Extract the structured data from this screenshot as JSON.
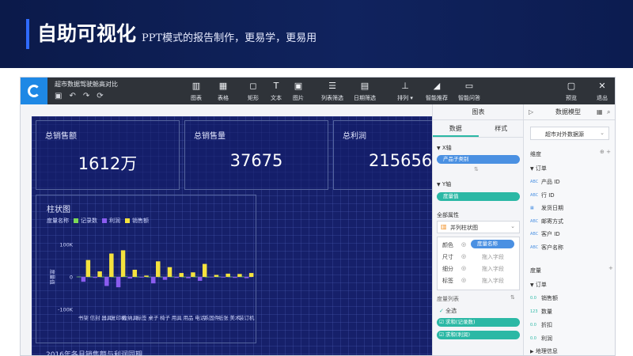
{
  "slide": {
    "title": "自助可视化",
    "subtitle": "PPT模式的报告制作，更易学，更易用"
  },
  "app": {
    "doc_title": "超市数据驾驶舱高对比",
    "toolbar": [
      {
        "icon": "bar-chart-icon",
        "glyph": "▥",
        "label": "图表"
      },
      {
        "icon": "table-icon",
        "glyph": "▦",
        "label": "表格"
      },
      {
        "icon": "rectangle-icon",
        "glyph": "◻",
        "label": "矩形"
      },
      {
        "icon": "text-icon",
        "glyph": "T",
        "label": "文本"
      },
      {
        "icon": "image-icon",
        "glyph": "▣",
        "label": "图片"
      },
      {
        "icon": "list-filter-icon",
        "glyph": "☰",
        "label": "列表筛选"
      },
      {
        "icon": "date-filter-icon",
        "glyph": "▤",
        "label": "日期筛选"
      },
      {
        "icon": "arrange-icon",
        "glyph": "⊥",
        "label": "排列 ▾"
      },
      {
        "icon": "smart-recommend-icon",
        "glyph": "◢",
        "label": "智能推荐"
      },
      {
        "icon": "smart-qa-icon",
        "glyph": "▭",
        "label": "智能问答"
      },
      {
        "icon": "preview-icon",
        "glyph": "▢",
        "label": "预览"
      },
      {
        "icon": "exit-icon",
        "glyph": "✕",
        "label": "退出"
      }
    ],
    "kpis": [
      {
        "title": "总销售额",
        "value": "1612万"
      },
      {
        "title": "总销售量",
        "value": "37675"
      },
      {
        "title": "总利润",
        "value": "215656"
      }
    ],
    "chart_title": "柱状图",
    "legend_label": "度量名称",
    "next_title": "2016年各月销售额与利润同期"
  },
  "chart_data": {
    "type": "bar",
    "title": "柱状图",
    "ylabel": "度量值",
    "ylim": [
      -100000,
      100000
    ],
    "ytick_labels": [
      "100K",
      "0",
      "-100K"
    ],
    "yticks": [
      100000,
      0,
      -100000
    ],
    "categories": [
      "书架",
      "信封",
      "器具",
      "复印机",
      "收纳具",
      "标签",
      "桌子",
      "椅子",
      "用具",
      "用品",
      "电话",
      "系固件",
      "纸张",
      "美术",
      "装订机"
    ],
    "series": [
      {
        "name": "记录数",
        "color": "#7cd957",
        "values": [
          700,
          700,
          500,
          400,
          1500,
          700,
          300,
          600,
          800,
          500,
          700,
          300,
          900,
          700,
          1000
        ]
      },
      {
        "name": "利润",
        "color": "#8a5cf0",
        "values": [
          -15000,
          -3000,
          -28000,
          -32000,
          -5000,
          -2000,
          -20000,
          -9000,
          -3000,
          -4000,
          -12000,
          -1000,
          -2000,
          -3000,
          -4000
        ]
      },
      {
        "name": "销售额",
        "color": "#f4e23e",
        "values": [
          52000,
          17000,
          72000,
          82000,
          22000,
          4000,
          48000,
          30000,
          12000,
          14000,
          40000,
          6000,
          10000,
          9000,
          12000
        ]
      }
    ]
  },
  "panel": {
    "chart_header": "图表",
    "tab_data": "数据",
    "tab_style": "样式",
    "x_axis_label": "X轴",
    "x_field": "产品子类别",
    "swap_glyph": "⇅",
    "y_axis_label": "Y轴",
    "y_field": "度量值",
    "global_props": "全部属性",
    "chart_type": "并列柱状图",
    "props": [
      {
        "label": "颜色",
        "value": "度量名称",
        "pill": true
      },
      {
        "label": "尺寸",
        "value": "拖入字段",
        "pill": false
      },
      {
        "label": "细分",
        "value": "拖入字段",
        "pill": false
      },
      {
        "label": "标签",
        "value": "拖入字段",
        "pill": false
      }
    ],
    "measure_list": "度量列表",
    "select_all": "全选",
    "measures_checked": [
      "求和(记录数)",
      "求和(利润)"
    ],
    "model_header": "数据模型",
    "datasource": "超市对外数据源",
    "dimension_title": "维度",
    "dim_group": "订单",
    "dimensions": [
      {
        "type": "ABC",
        "name": "产品 ID"
      },
      {
        "type": "ABC",
        "name": "行 ID"
      },
      {
        "type": "▦",
        "name": "发货日期"
      },
      {
        "type": "ABC",
        "name": "邮寄方式"
      },
      {
        "type": "ABC",
        "name": "客户 ID"
      },
      {
        "type": "ABC",
        "name": "客户名称"
      }
    ],
    "measure_title": "度量",
    "mea_group": "订单",
    "measures": [
      {
        "type": "0.0",
        "name": "销售额"
      },
      {
        "type": "123",
        "name": "数量"
      },
      {
        "type": "0.0",
        "name": "折扣"
      },
      {
        "type": "0.0",
        "name": "利润"
      }
    ],
    "geo_group": "地理信息"
  },
  "colors": {
    "accent": "#2bb8a5",
    "brand_blue": "#1e88e5",
    "canvas_bg": "#16206a"
  }
}
